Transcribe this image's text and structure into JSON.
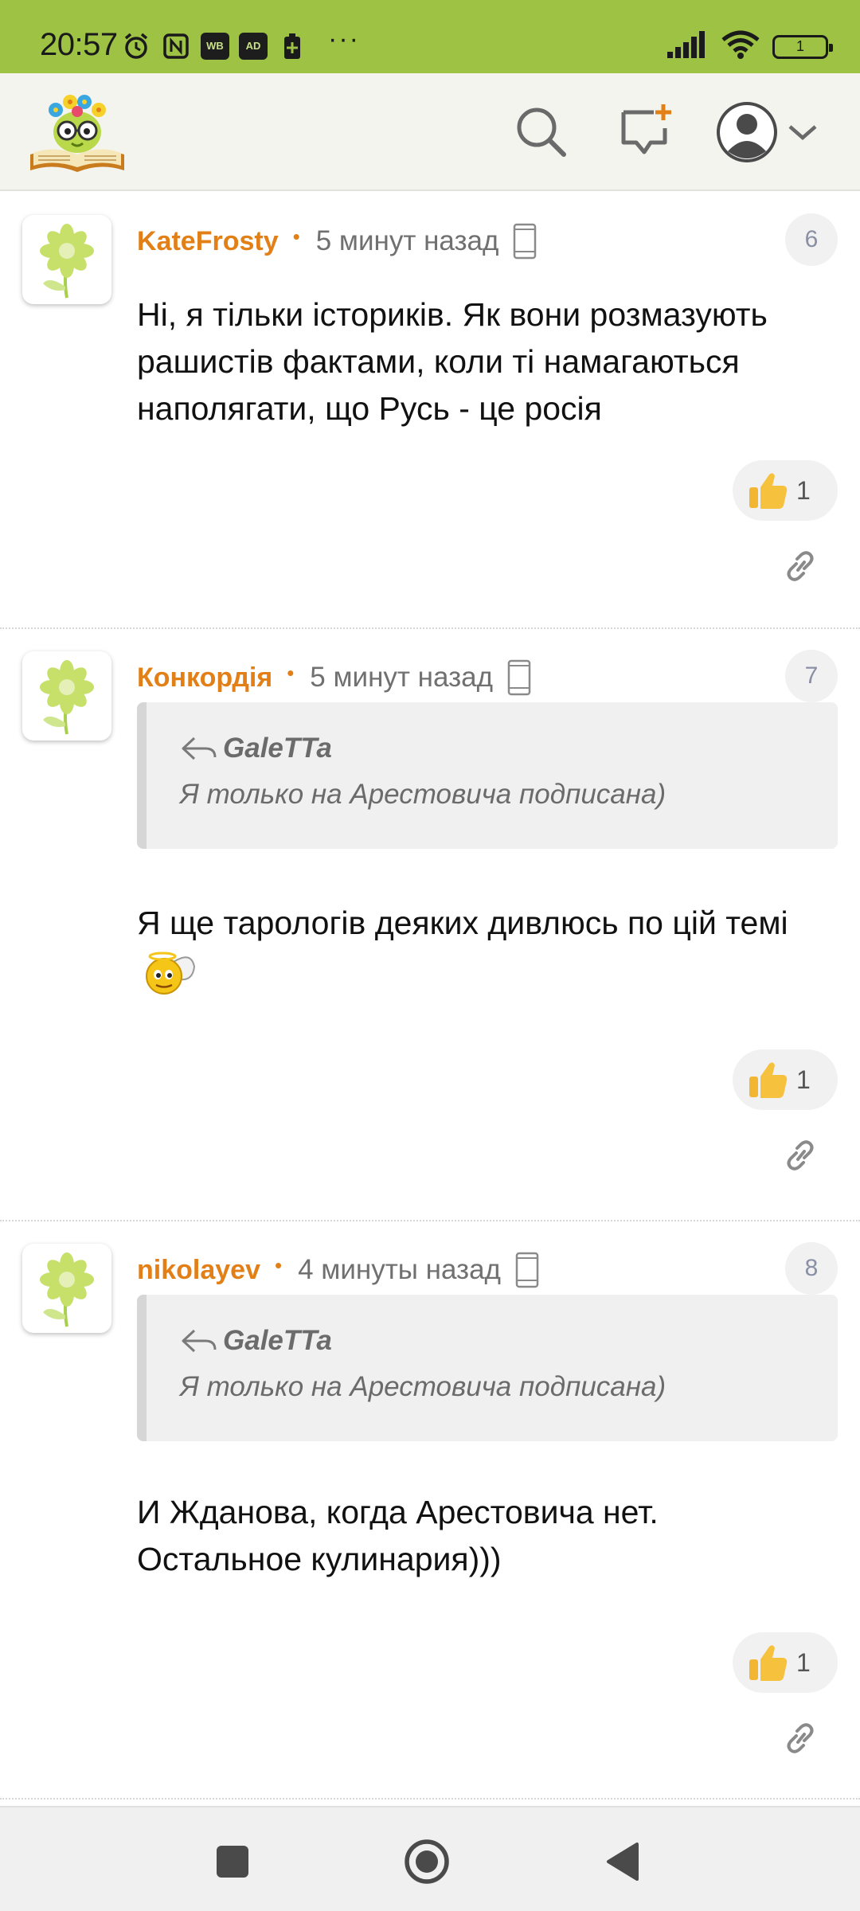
{
  "status_bar": {
    "time": "20:57",
    "left_icons": [
      "alarm-icon",
      "nfc-icon",
      "wb-app-icon",
      "adblocker-icon",
      "battery-saver-icon"
    ],
    "wb_label": "WB",
    "ad_label": "AD",
    "more": "···",
    "battery_level": "1"
  },
  "header": {
    "logo": "site-logo",
    "actions": [
      "search-icon",
      "new-message-icon",
      "user-avatar-icon",
      "chevron-down-icon"
    ]
  },
  "comments": [
    {
      "author": "KateFrosty",
      "time": "5 минут назад",
      "number": "6",
      "text": "Ні, я тільки істориків. Як вони розмазують рашистів фактами, коли ті намагаються наполягати, що Русь - це росія",
      "likes": "1"
    },
    {
      "author": "Конкордія",
      "time": "5 минут назад",
      "number": "7",
      "quote": {
        "author": "GaleTTa",
        "text": "Я только на Арестовича подписана)"
      },
      "text": "Я ще тарологів деяких дивлюсь по цій темі",
      "likes": "1"
    },
    {
      "author": "nikolayev",
      "time": "4 минуты назад",
      "number": "8",
      "quote": {
        "author": "GaleTTa",
        "text": "Я только на Арестовича подписана)"
      },
      "text": "И Жданова, когда Арестовича нет. Остальное кулинария)))",
      "likes": "1"
    }
  ],
  "nav": [
    "recents-button",
    "home-button",
    "back-button"
  ],
  "colors": {
    "status_bar": "#9dc244",
    "author": "#e27f17",
    "header_bg": "#f4f4ef"
  }
}
